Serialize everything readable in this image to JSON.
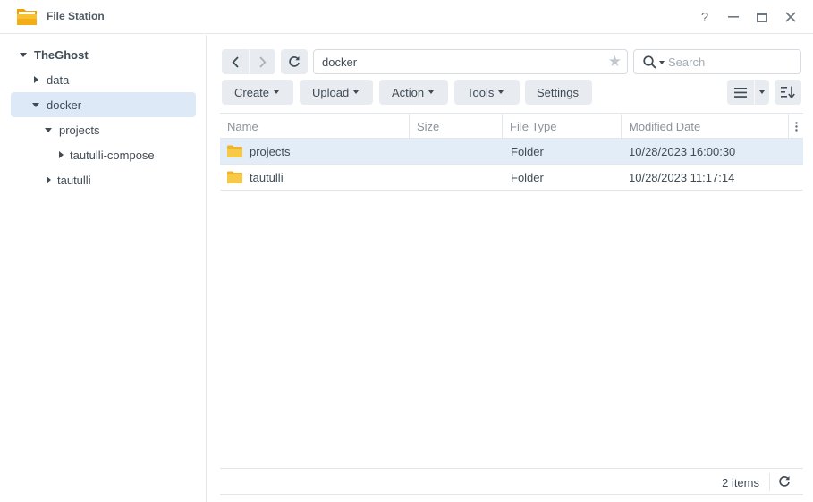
{
  "window": {
    "title": "File Station",
    "help_label": "?"
  },
  "sidebar": {
    "items": [
      {
        "label": "TheGhost",
        "expanded": true
      },
      {
        "label": "data",
        "expanded": false
      },
      {
        "label": "docker",
        "expanded": true,
        "selected": true
      },
      {
        "label": "projects",
        "expanded": true
      },
      {
        "label": "tautulli-compose",
        "expanded": false
      },
      {
        "label": "tautulli",
        "expanded": false
      }
    ]
  },
  "toolbar": {
    "path": "docker",
    "search_placeholder": "Search",
    "buttons": [
      "Create",
      "Upload",
      "Action",
      "Tools",
      "Settings"
    ]
  },
  "grid": {
    "columns": [
      "Name",
      "Size",
      "File Type",
      "Modified Date"
    ],
    "rows": [
      {
        "name": "projects",
        "size": "",
        "type": "Folder",
        "modified": "10/28/2023 16:00:30",
        "selected": true
      },
      {
        "name": "tautulli",
        "size": "",
        "type": "Folder",
        "modified": "10/28/2023 11:17:14",
        "selected": false
      }
    ]
  },
  "footer": {
    "count": "2 items"
  },
  "colors": {
    "accent_selected": "#dde9f7",
    "button_bg": "#e8ecf0",
    "folder": "#f5c242"
  }
}
